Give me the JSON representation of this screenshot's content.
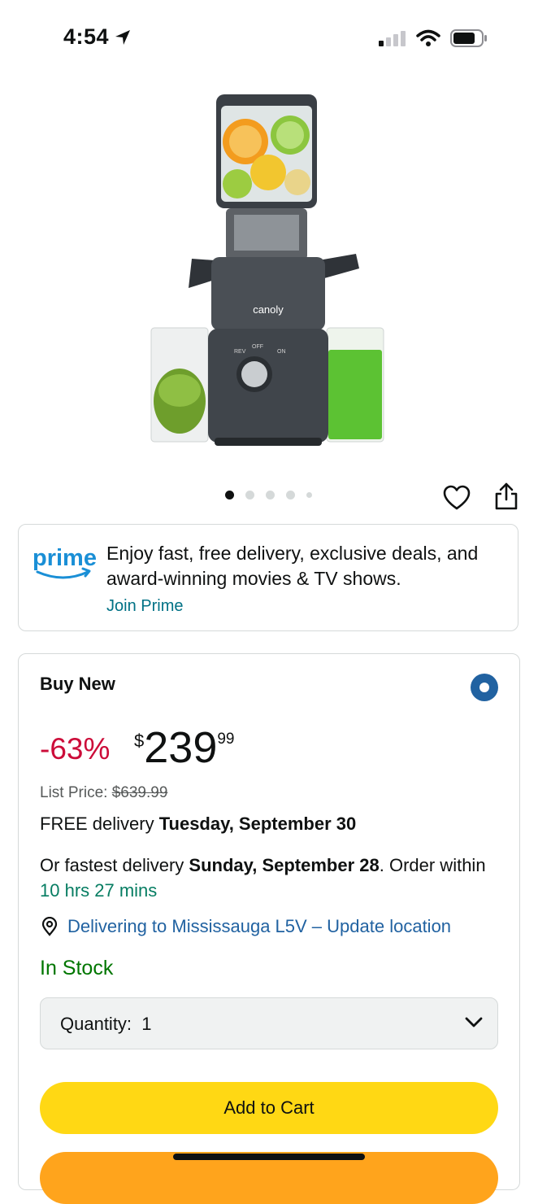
{
  "status_bar": {
    "time": "4:54"
  },
  "gallery": {
    "image_count": 5,
    "active_index": 0
  },
  "product_image": {
    "brand_text": "canoly",
    "panel_labels": [
      "REV",
      "OFF",
      "ON"
    ]
  },
  "prime": {
    "logo_text": "prime",
    "message": "Enjoy fast, free delivery, exclusive deals, and award-winning movies & TV shows.",
    "join_label": "Join Prime"
  },
  "buy_box": {
    "title": "Buy New",
    "discount": "-63%",
    "price_symbol": "$",
    "price_whole": "239",
    "price_fraction": "99",
    "list_price_label": "List Price: ",
    "list_price_value": "$639.99",
    "free_delivery_prefix": "FREE delivery ",
    "free_delivery_date": "Tuesday, September 30",
    "fastest_prefix": "Or fastest delivery ",
    "fastest_date": "Sunday, September 28",
    "fastest_mid": ". Order within ",
    "order_within": "10 hrs 27 mins",
    "location_text": "Delivering to Mississauga L5V – Update location",
    "stock": "In Stock",
    "quantity_label": "Quantity:",
    "quantity_value": "1",
    "add_to_cart": "Add to Cart"
  },
  "colors": {
    "prime_blue": "#00a8e1",
    "link": "#007185",
    "deal_red": "#cc0c39",
    "stock_green": "#007600",
    "add_to_cart": "#ffd814",
    "buy_now": "#ffa41c"
  }
}
